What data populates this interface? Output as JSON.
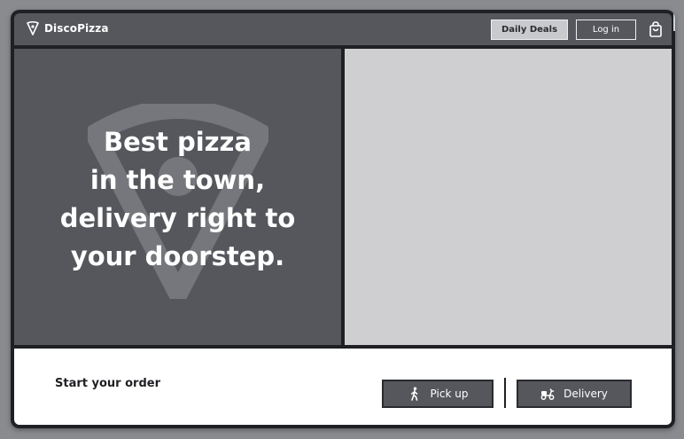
{
  "header": {
    "logo_text": "DiscoPizza",
    "logo_icon": "pizza-slice-icon",
    "daily_deals_label": "Daily Deals",
    "login_label": "Log in",
    "cart_icon": "shopping-bag-icon"
  },
  "hero": {
    "lines": [
      "Best pizza",
      "in the town,",
      "delivery right to",
      "your doorstep."
    ],
    "watermark_icon": "pizza-slice-icon"
  },
  "order": {
    "prompt": "Start your order",
    "pickup_label": "Pick up",
    "pickup_icon": "walking-person-icon",
    "delivery_label": "Delivery",
    "delivery_icon": "scooter-icon"
  },
  "colors": {
    "header_bg": "#55575d",
    "hero_left_bg": "#55575d",
    "hero_right_bg": "#cfcfd1",
    "frame": "#1f2024",
    "deals_button_bg": "#c9cacd"
  }
}
